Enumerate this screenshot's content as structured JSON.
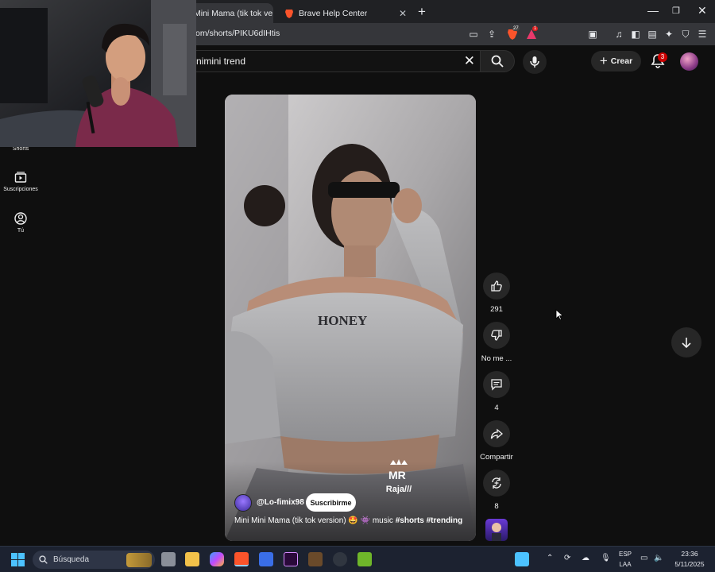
{
  "browser": {
    "tabs": [
      {
        "label": "Mini Mama (tik tok ve"
      },
      {
        "label": "Brave Help Center"
      }
    ],
    "url": "om/shorts/PIKU6dIHtis",
    "shield_count": "27",
    "alert_count": "1"
  },
  "youtube": {
    "search_query": "nimini trend",
    "create_label": "Crear",
    "notification_count": "3"
  },
  "sidebar": {
    "items": [
      {
        "label": "Shorts",
        "icon": "shorts-icon"
      },
      {
        "label": "Suscripciones",
        "icon": "subscriptions-icon"
      },
      {
        "label": "Tú",
        "icon": "you-icon"
      }
    ]
  },
  "video": {
    "channel": "@Lo-fimix98",
    "subscribe_label": "Suscribirme",
    "caption_prefix": "Mini Mini Mama (tik tok version) 🤩 👾 music ",
    "hashtags": [
      "#shorts",
      "#trending"
    ],
    "watermark": "Raja///",
    "shirt_text": "HONEY"
  },
  "actions": {
    "likes": "291",
    "dislike_label": "No me ...",
    "comments": "4",
    "share_label": "Compartir",
    "remix_count": "8"
  },
  "taskbar": {
    "search_placeholder": "Búsqueda",
    "lang_top": "ESP",
    "lang_bottom": "LAA",
    "time": "23:36",
    "date": "5/11/2025"
  },
  "colors": {
    "background": "#0f0f0f",
    "button_bg": "#272727",
    "brand_red": "#cc0000",
    "taskbar": "#1c2230"
  }
}
